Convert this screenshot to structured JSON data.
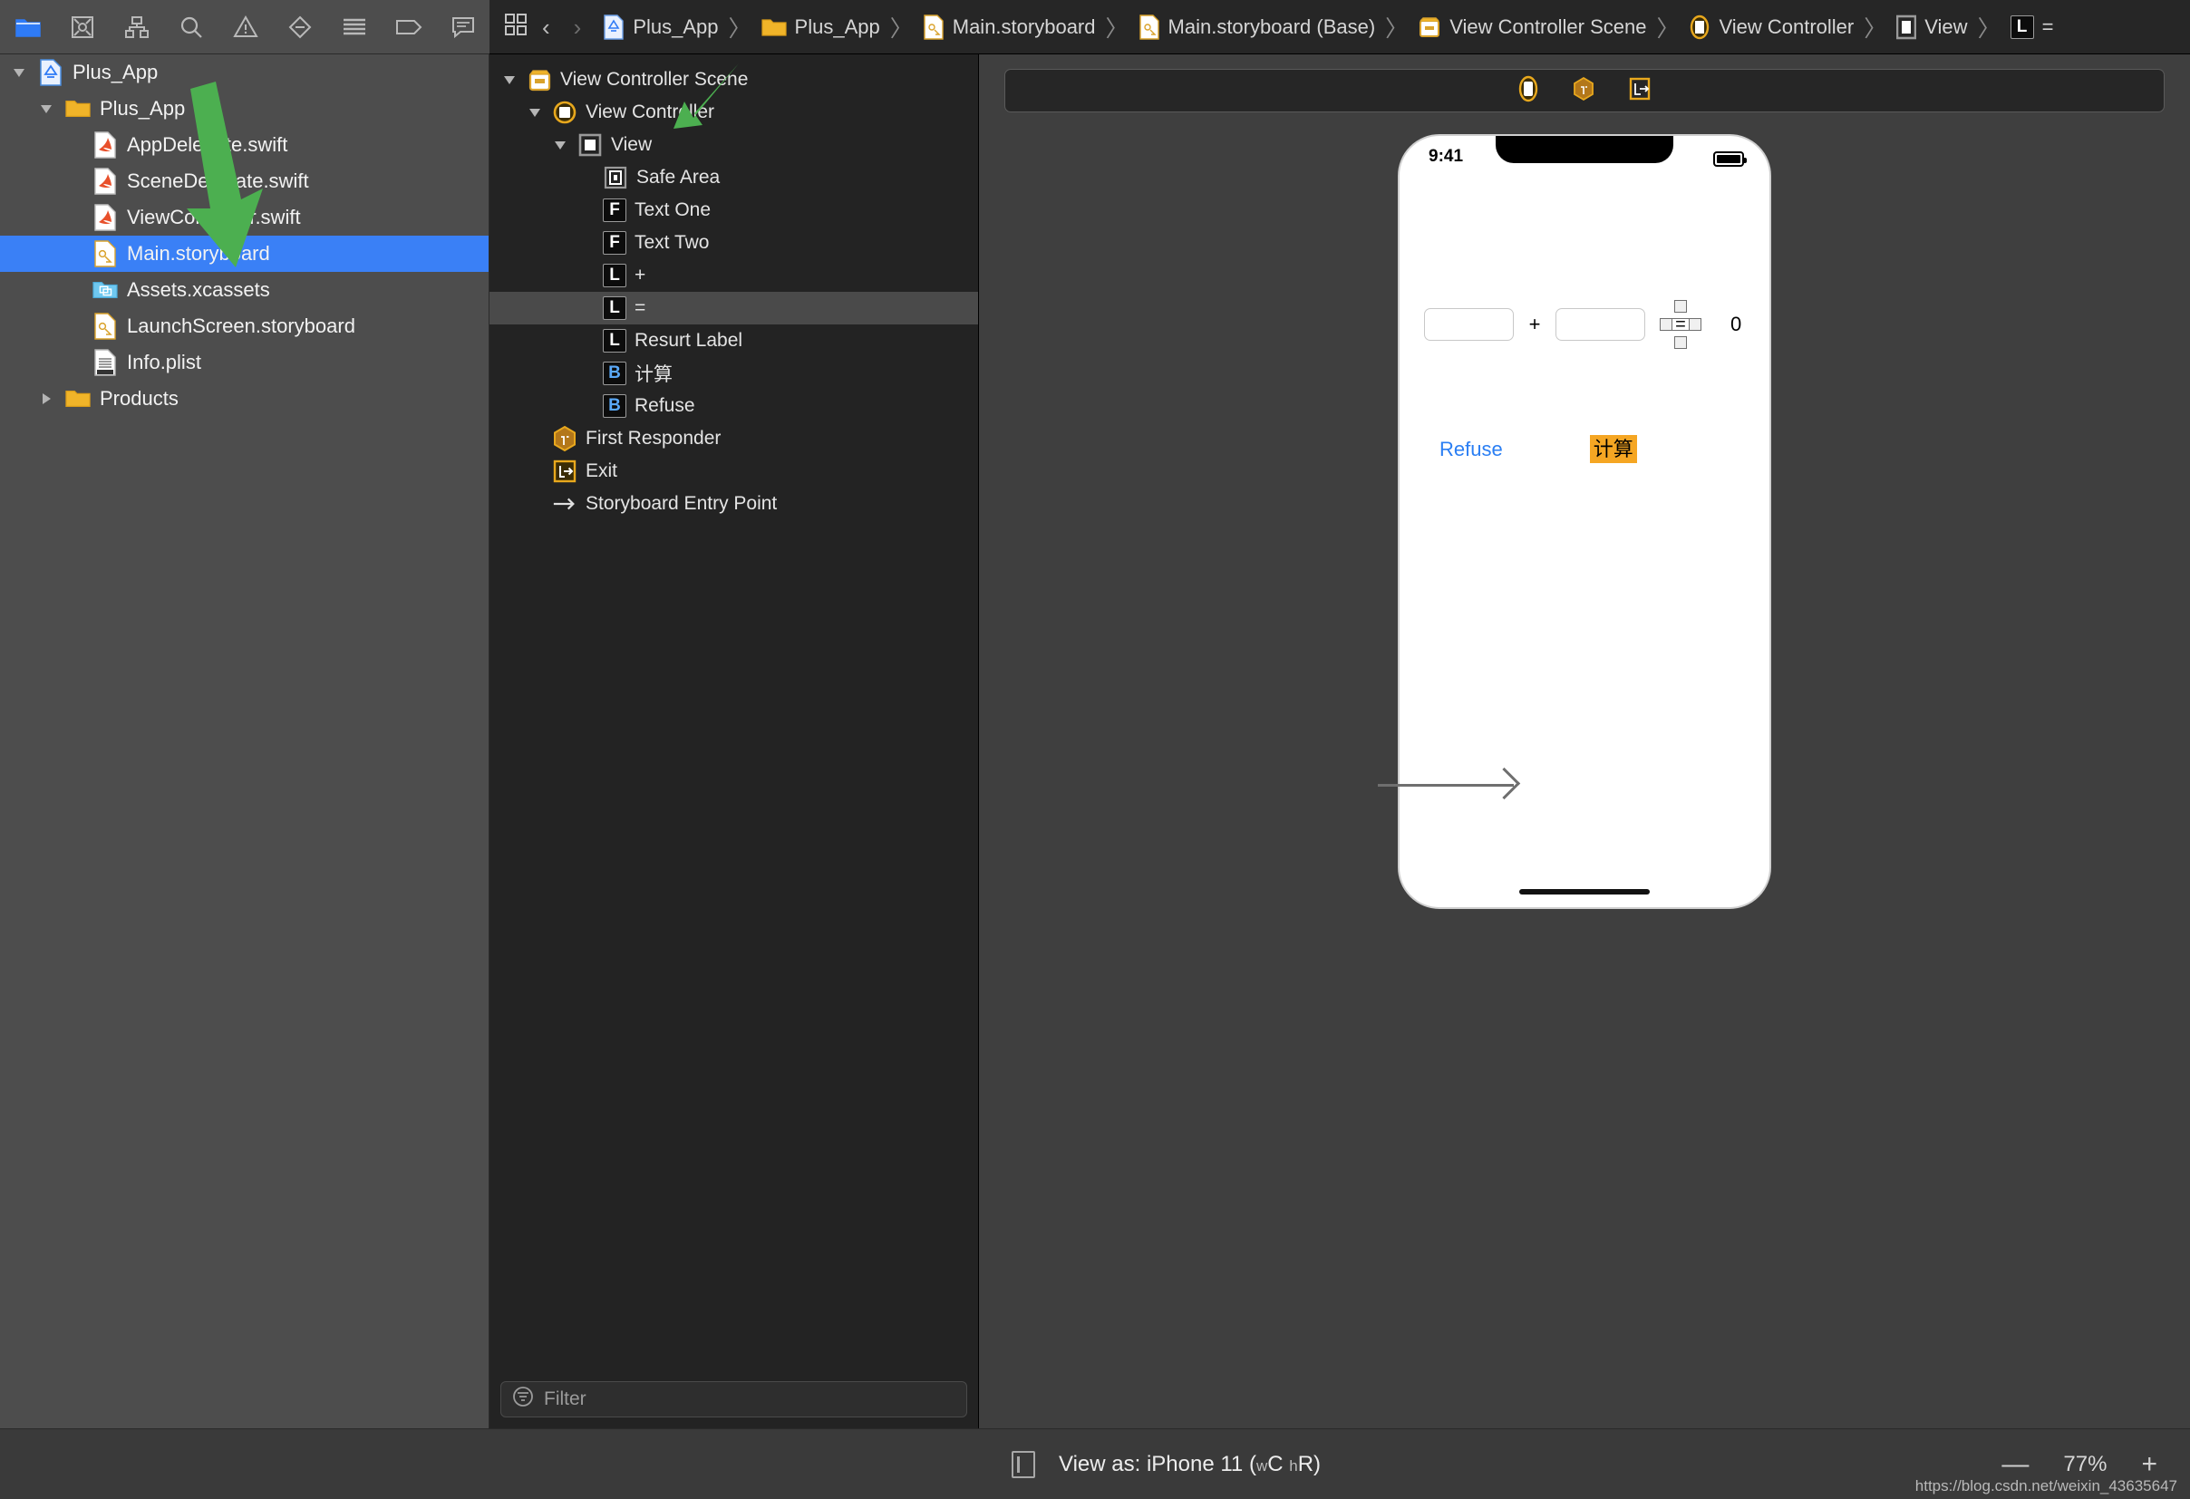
{
  "toolbar": {
    "icons": [
      {
        "name": "folder-icon",
        "label": "Project navigator"
      },
      {
        "name": "source-control-icon",
        "label": "Source control navigator"
      },
      {
        "name": "symbol-hierarchy-icon",
        "label": "Symbol navigator"
      },
      {
        "name": "search-icon",
        "label": "Find navigator"
      },
      {
        "name": "warning-triangle-icon",
        "label": "Issue navigator"
      },
      {
        "name": "test-diamond-icon",
        "label": "Test navigator"
      },
      {
        "name": "debug-list-icon",
        "label": "Debug navigator"
      },
      {
        "name": "breakpoint-tag-icon",
        "label": "Breakpoint navigator"
      },
      {
        "name": "report-bubble-icon",
        "label": "Report navigator"
      }
    ]
  },
  "breadcrumb": {
    "grid_icon": "assistant-grid-icon",
    "back_arrow": "‹",
    "forward_arrow": "›",
    "separator": "〉",
    "items": [
      {
        "label": "Plus_App",
        "icon": "xcode-project-icon"
      },
      {
        "label": "Plus_App",
        "icon": "folder-icon"
      },
      {
        "label": "Main.storyboard",
        "icon": "storyboard-icon"
      },
      {
        "label": "Main.storyboard (Base)",
        "icon": "storyboard-icon"
      },
      {
        "label": "View Controller Scene",
        "icon": "scene-icon"
      },
      {
        "label": "View Controller",
        "icon": "view-controller-icon"
      },
      {
        "label": "View",
        "icon": "view-icon"
      },
      {
        "label": "=",
        "icon": "label-badge-icon"
      }
    ]
  },
  "navigator": {
    "items": [
      {
        "label": "Plus_App",
        "icon": "xcode-project-icon",
        "depth": 0,
        "disclosure": "open",
        "selected": false
      },
      {
        "label": "Plus_App",
        "icon": "folder-icon",
        "depth": 1,
        "disclosure": "open",
        "selected": false
      },
      {
        "label": "AppDelegate.swift",
        "icon": "swift-file-icon",
        "depth": 2,
        "disclosure": "none",
        "selected": false
      },
      {
        "label": "SceneDelegate.swift",
        "icon": "swift-file-icon",
        "depth": 2,
        "disclosure": "none",
        "selected": false
      },
      {
        "label": "ViewController.swift",
        "icon": "swift-file-icon",
        "depth": 2,
        "disclosure": "none",
        "selected": false
      },
      {
        "label": "Main.storyboard",
        "icon": "storyboard-icon",
        "depth": 2,
        "disclosure": "none",
        "selected": true
      },
      {
        "label": "Assets.xcassets",
        "icon": "assets-icon",
        "depth": 2,
        "disclosure": "none",
        "selected": false
      },
      {
        "label": "LaunchScreen.storyboard",
        "icon": "storyboard-icon",
        "depth": 2,
        "disclosure": "none",
        "selected": false
      },
      {
        "label": "Info.plist",
        "icon": "plist-icon",
        "depth": 2,
        "disclosure": "none",
        "selected": false
      },
      {
        "label": "Products",
        "icon": "folder-icon",
        "depth": 1,
        "disclosure": "closed",
        "selected": false
      }
    ]
  },
  "outline": {
    "items": [
      {
        "label": "View Controller Scene",
        "icon": "scene-icon",
        "depth": 0,
        "disclosure": "open",
        "selected": false,
        "badge": ""
      },
      {
        "label": "View Controller",
        "icon": "view-controller-icon",
        "depth": 1,
        "disclosure": "open",
        "selected": false,
        "badge": ""
      },
      {
        "label": "View",
        "icon": "view-icon",
        "depth": 2,
        "disclosure": "open",
        "selected": false,
        "badge": ""
      },
      {
        "label": "Safe Area",
        "icon": "safe-area-icon",
        "depth": 3,
        "disclosure": "none",
        "selected": false,
        "badge": ""
      },
      {
        "label": "Text One",
        "icon": "textfield-badge-icon",
        "depth": 3,
        "disclosure": "none",
        "selected": false,
        "badge": "F"
      },
      {
        "label": "Text Two",
        "icon": "textfield-badge-icon",
        "depth": 3,
        "disclosure": "none",
        "selected": false,
        "badge": "F"
      },
      {
        "label": "+",
        "icon": "label-badge-icon",
        "depth": 3,
        "disclosure": "none",
        "selected": false,
        "badge": "L"
      },
      {
        "label": "=",
        "icon": "label-badge-icon",
        "depth": 3,
        "disclosure": "none",
        "selected": true,
        "badge": "L"
      },
      {
        "label": "Resurt Label",
        "icon": "label-badge-icon",
        "depth": 3,
        "disclosure": "none",
        "selected": false,
        "badge": "L"
      },
      {
        "label": "计算",
        "icon": "button-badge-icon",
        "depth": 3,
        "disclosure": "none",
        "selected": false,
        "badge": "B"
      },
      {
        "label": "Refuse",
        "icon": "button-badge-icon",
        "depth": 3,
        "disclosure": "none",
        "selected": false,
        "badge": "B"
      },
      {
        "label": "First Responder",
        "icon": "first-responder-icon",
        "depth": 1,
        "disclosure": "none",
        "selected": false,
        "badge": ""
      },
      {
        "label": "Exit",
        "icon": "exit-icon",
        "depth": 1,
        "disclosure": "none",
        "selected": false,
        "badge": ""
      },
      {
        "label": "Storyboard Entry Point",
        "icon": "entry-point-arrow-icon",
        "depth": 1,
        "disclosure": "none",
        "selected": false,
        "badge": ""
      }
    ],
    "filter": {
      "placeholder": "Filter",
      "value": "",
      "icon": "filter-funnel-icon"
    }
  },
  "canvas": {
    "scene_dock_icons": [
      {
        "name": "view-controller-dock-icon"
      },
      {
        "name": "first-responder-dock-icon"
      },
      {
        "name": "exit-dock-icon"
      }
    ],
    "phone": {
      "status_time": "9:41",
      "battery_icon": "battery-icon",
      "text_field_one_value": "",
      "text_field_one_placeholder": "",
      "text_field_two_value": "",
      "text_field_two_placeholder": "",
      "plus_label": "+",
      "equals_label": "=",
      "result_label": "0",
      "refuse_button": "Refuse",
      "calc_button": "计算",
      "calc_button_color": "#f5a623",
      "refuse_button_color": "#2a7ef3"
    }
  },
  "bottombar": {
    "view_as_prefix": "View as:",
    "device": "iPhone 11",
    "size_class_w": "w",
    "size_class_wc": "C",
    "size_class_h": "h",
    "size_class_hr": "R",
    "zoom_out": "—",
    "zoom_level": "77%",
    "zoom_in": "+",
    "watermark": "https://blog.csdn.net/weixin_43635647"
  },
  "annotations": {
    "navigator_arrow_color": "#4caf50",
    "outline_arrow_color": "#4caf50",
    "canvas_arrow_color": "#6f6f6f"
  }
}
